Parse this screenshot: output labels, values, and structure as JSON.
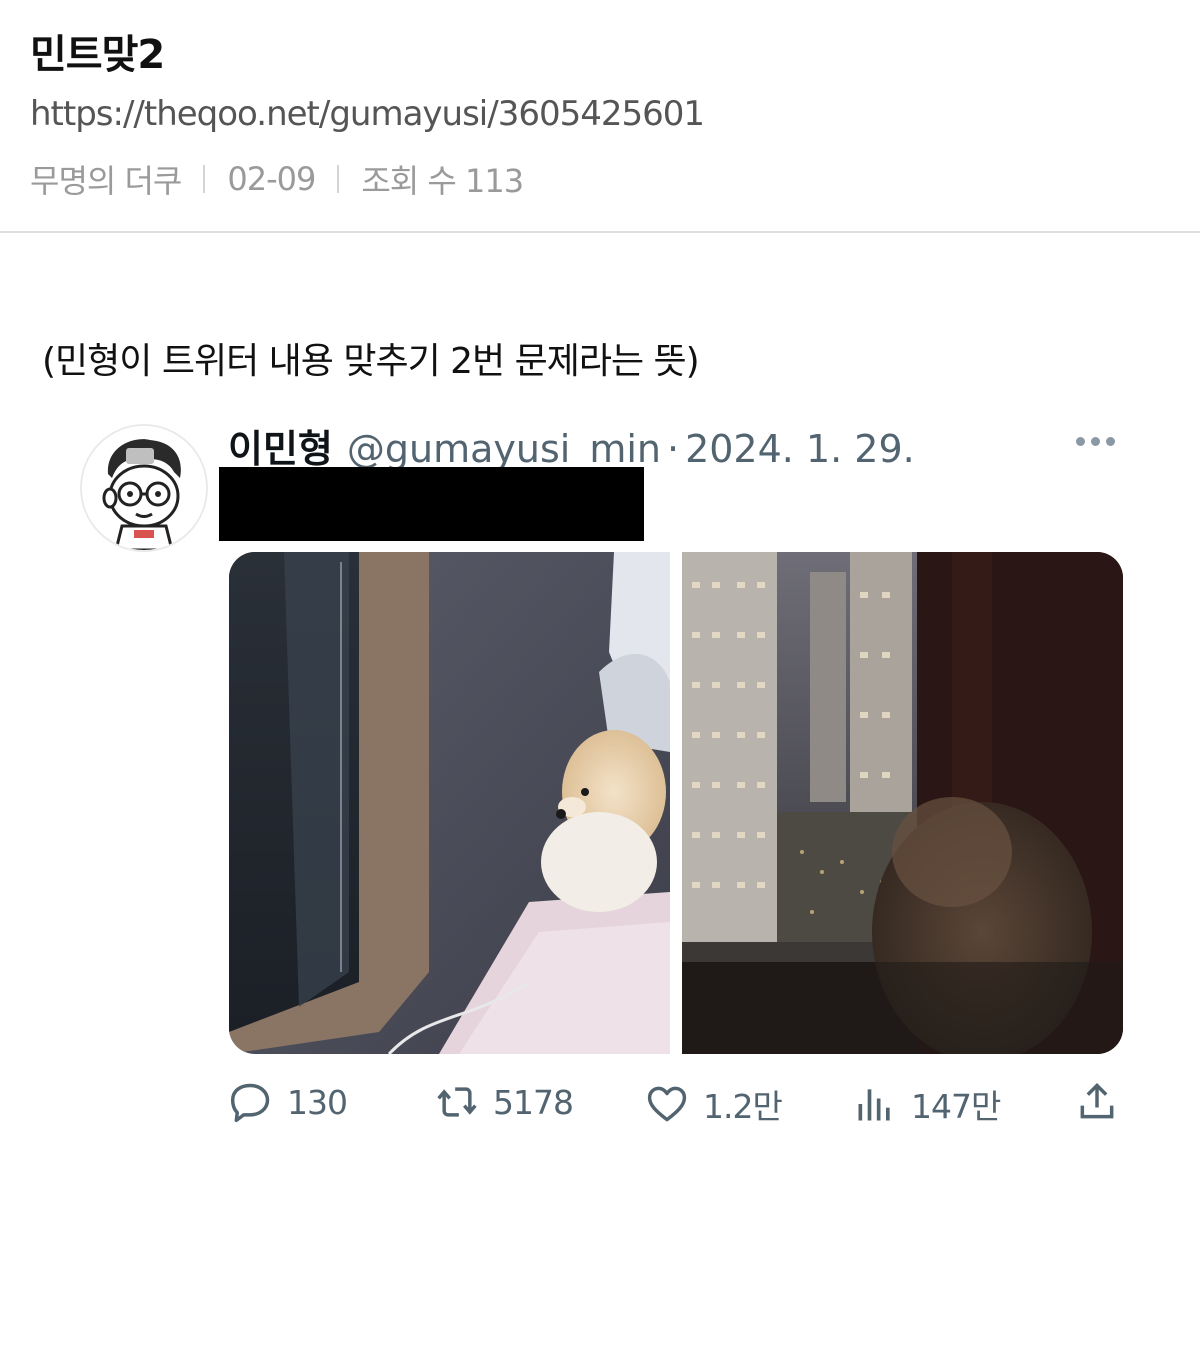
{
  "post": {
    "title": "민트맞2",
    "url": "https://theqoo.net/gumayusi/3605425601",
    "author": "무명의 더쿠",
    "date": "02-09",
    "views_label": "조회 수 113"
  },
  "body": {
    "caption": "(민형이 트위터 내용 맞추기 2번 문제라는 뜻)"
  },
  "tweet": {
    "display_name": "이민형",
    "handle": "@gumayusi_min",
    "separator": "·",
    "date": "2024. 1. 29.",
    "more_icon": "more-horizontal-icon",
    "avatar_icon": "cartoon-avatar-glasses",
    "media": [
      {
        "description_icon": "dog-by-window-photo"
      },
      {
        "description_icon": "dog-night-city-photo"
      }
    ],
    "actions": {
      "reply_count": "130",
      "retweet_count": "5178",
      "like_count": "1.2만",
      "view_count": "147만"
    }
  },
  "colors": {
    "muted_text": "#536471",
    "meta_text": "#9a9a9a",
    "divider": "#dedede",
    "redaction": "#000000"
  }
}
